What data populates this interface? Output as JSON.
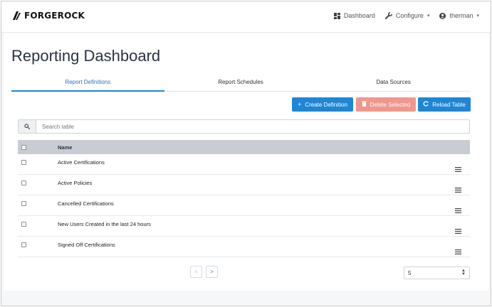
{
  "brand": {
    "name": "FORGEROCK"
  },
  "nav": {
    "dashboard": "Dashboard",
    "configure": "Configure",
    "user": "therman"
  },
  "page": {
    "title": "Reporting Dashboard"
  },
  "tabs": [
    {
      "label": "Report Definitions",
      "active": true
    },
    {
      "label": "Report Schedules",
      "active": false
    },
    {
      "label": "Data Sources",
      "active": false
    }
  ],
  "toolbar": {
    "create": "Create Definition",
    "delete": "Delete Selected",
    "reload": "Reload Table"
  },
  "search": {
    "placeholder": "Search table",
    "value": ""
  },
  "table": {
    "header": "Name",
    "rows": [
      "Active Certifications",
      "Active Policies",
      "Cancelled Certifications",
      "New Users Created in the last 24 hours",
      "Signed Off Certifications"
    ]
  },
  "pagination": {
    "prev": "<",
    "next": ">",
    "page_size": "5"
  },
  "colors": {
    "primary": "#1f86d6",
    "danger_disabled": "#f1968c",
    "header_bg": "#c9cdd3"
  },
  "icons": [
    "dashboard-icon",
    "wrench-icon",
    "user-circle-icon",
    "search-icon",
    "plus-icon",
    "trash-icon",
    "refresh-icon",
    "hamburger-menu-icon"
  ]
}
